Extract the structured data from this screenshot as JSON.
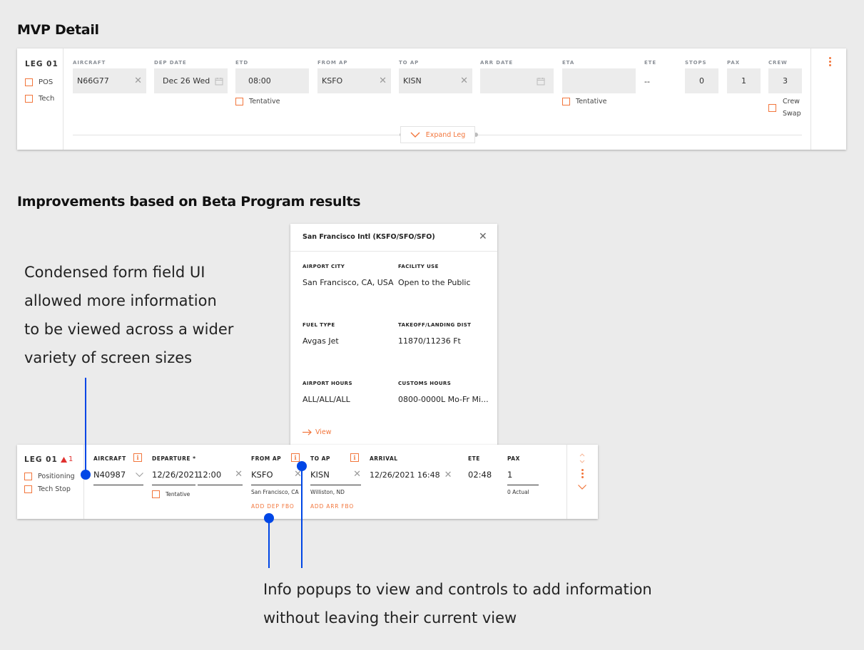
{
  "mvp": {
    "title": "MVP Detail",
    "leg": "LEG 01",
    "checks": [
      "POS",
      "Tech"
    ],
    "labels": {
      "aircraft": "AIRCRAFT",
      "dep_date": "DEP DATE",
      "etd": "ETD",
      "from_ap": "FROM AP",
      "to_ap": "TO AP",
      "arr_date": "ARR DATE",
      "eta": "ETA",
      "ete": "ETE",
      "stops": "STOPS",
      "pax": "PAX",
      "crew": "CREW"
    },
    "values": {
      "aircraft": "N66G77",
      "dep_date": "Dec 26 Wed",
      "etd": "08:00",
      "from_ap": "KSFO",
      "to_ap": "KISN",
      "arr_date": "",
      "eta": "",
      "ete": "--",
      "stops": "0",
      "pax": "1",
      "crew": "3"
    },
    "tentative": "Tentative",
    "tentative2": "Tentative",
    "crew_swap_1": "Crew",
    "crew_swap_2": "Swap",
    "expand": "Expand Leg"
  },
  "improved": {
    "title": "Improvements based on Beta Program results",
    "leg": "LEG 01",
    "warning_count": "1",
    "checks": [
      "Positioning",
      "Tech Stop"
    ],
    "labels": {
      "aircraft": "AIRCRAFT",
      "departure": "DEPARTURE *",
      "from_ap": "FROM AP",
      "to_ap": "TO AP",
      "arrival": "ARRIVAL",
      "ete": "ETE",
      "pax": "PAX"
    },
    "values": {
      "aircraft": "N40987",
      "dep_date": "12/26/2021",
      "dep_time": "12:00",
      "from_ap": "KSFO",
      "to_ap": "KISN",
      "arrival": "12/26/2021 16:48",
      "ete": "02:48",
      "pax": "1"
    },
    "from_city": "San Francisco, CA",
    "to_city": "Williston, ND",
    "pax_actual": "0 Actual",
    "tentative": "Tentative",
    "add_dep_fbo": "ADD DEP FBO",
    "add_arr_fbo": "ADD ARR FBO",
    "info_glyph": "i"
  },
  "popup": {
    "title": "San Francisco Intl (KSFO/SFO/SFO)",
    "fields": [
      {
        "label": "AIRPORT CITY",
        "value": "San Francisco, CA, USA"
      },
      {
        "label": "FACILITY USE",
        "value": "Open to the Public"
      },
      {
        "label": "FUEL TYPE",
        "value": "Avgas Jet"
      },
      {
        "label": "TAKEOFF/LANDING DIST",
        "value": "11870/11236 Ft"
      },
      {
        "label": "AIRPORT HOURS",
        "value": "ALL/ALL/ALL"
      },
      {
        "label": "CUSTOMS HOURS",
        "value": "0800-0000L Mo-Fr Mi..."
      }
    ],
    "view": "View"
  },
  "annotations": {
    "left": [
      "Condensed form field UI",
      "allowed more information",
      "to be viewed across a wider",
      "variety of screen sizes"
    ],
    "bottom": [
      "Info popups to view and controls to add information",
      "without leaving their current view"
    ]
  },
  "colors": {
    "accent": "#f2763c",
    "annotation": "#0046e6",
    "warning": "#e0312f"
  }
}
